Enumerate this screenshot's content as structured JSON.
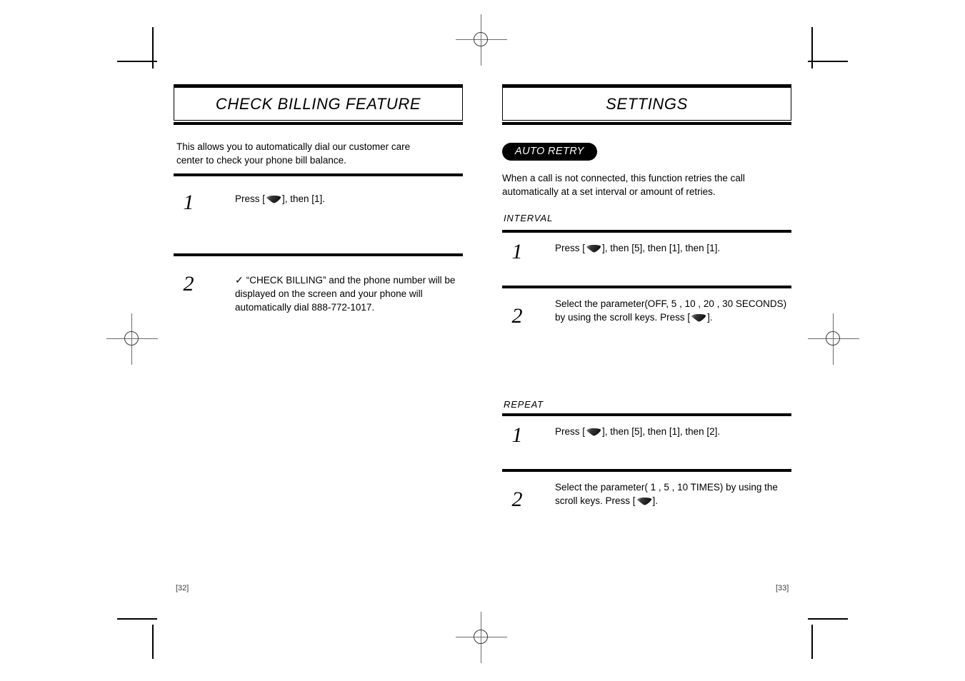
{
  "document": {
    "type": "printed-manual-spread",
    "page_numbers": {
      "left": "[32]",
      "right": "[33]"
    },
    "icons": {
      "send_key": "send-key-icon",
      "check": "✓"
    }
  },
  "left_page": {
    "header_title": "CHECK BILLING FEATURE",
    "intro": "This allows you to automatically dial our customer care center to check your phone bill balance.",
    "steps": [
      {
        "number": "1",
        "text_before_icon": "Press [",
        "text_after_icon": "], then [1]."
      },
      {
        "number": "2",
        "check": "✓",
        "text": "“CHECK BILLING” and the phone number will be displayed on the screen and your phone will automatically dial 888-772-1017."
      }
    ]
  },
  "right_page": {
    "header_title": "SETTINGS",
    "badge_label": "AUTO RETRY",
    "intro": "When a call is not connected, this function retries the call automatically at a set interval or amount of retries.",
    "sections": [
      {
        "label": "INTERVAL",
        "steps": [
          {
            "number": "1",
            "text_before_icon": "Press [",
            "text_after_icon": "], then [5], then [1], then [1]."
          },
          {
            "number": "2",
            "text_before_icon": "Select the parameter(OFF, 5 , 10 , 20 , 30 SECONDS) by using the scroll keys. Press [",
            "text_after_icon": "]."
          }
        ]
      },
      {
        "label": "REPEAT",
        "steps": [
          {
            "number": "1",
            "text_before_icon": "Press [",
            "text_after_icon": "], then [5], then [1], then [2]."
          },
          {
            "number": "2",
            "text_before_icon": "Select the parameter( 1 , 5 , 10 TIMES) by using the scroll keys. Press [",
            "text_after_icon": "]."
          }
        ]
      }
    ]
  }
}
